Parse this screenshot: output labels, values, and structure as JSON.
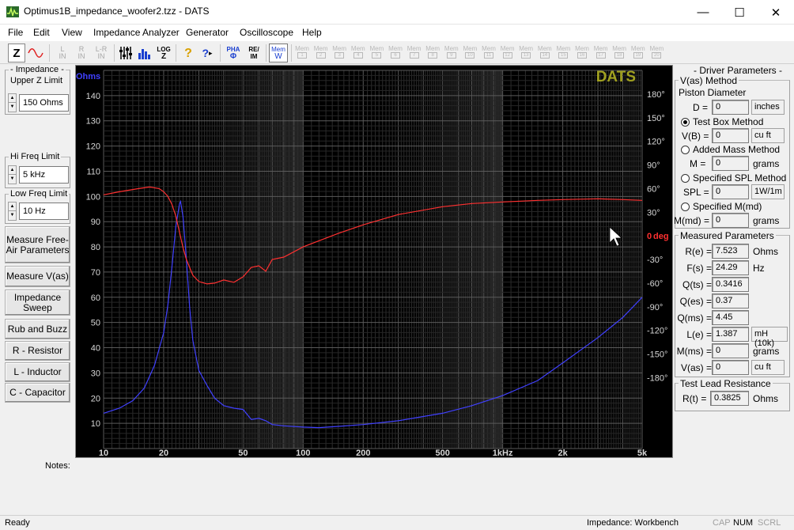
{
  "window": {
    "title": "Optimus1B_impedance_woofer2.tzz - DATS",
    "minimize_glyph": "—",
    "maximize_glyph": "☐",
    "close_glyph": "✕"
  },
  "menu": [
    "File",
    "Edit",
    "View",
    "Impedance Analyzer",
    "Generator",
    "Oscilloscope",
    "Help"
  ],
  "toolbar": {
    "z_label": "Z",
    "l_in": "L IN",
    "r_in": "R IN",
    "lr_in": "L-R IN",
    "log_label": "LOG",
    "log_sub": "Z",
    "help_glyph": "?",
    "context_help_glyph": "?",
    "pha_label": "PHA",
    "pha_sub": "Φ",
    "re_im_top": "RE/",
    "re_im_bottom": "IM",
    "mem_label": "Mem",
    "mem_sub": "W",
    "mem_slot_label": "Mem",
    "mem_slots": [
      "1",
      "2",
      "3",
      "4",
      "5",
      "6",
      "7",
      "8",
      "9",
      "10",
      "11",
      "12",
      "13",
      "14",
      "15",
      "16",
      "17",
      "18",
      "19",
      "20"
    ]
  },
  "left": {
    "upper_z": {
      "legend1": "- Impedance -",
      "legend2": "Upper Z Limit",
      "value": "150 Ohms"
    },
    "hi_freq": {
      "legend": "Hi Freq Limit",
      "value": "5 kHz"
    },
    "low_freq": {
      "legend": "Low Freq Limit",
      "value": "10 Hz"
    },
    "buttons": {
      "measure_free_air": "Measure Free-Air Parameters",
      "measure_vas": "Measure V(as)",
      "impedance_sweep": "Impedance Sweep",
      "rub_buzz": "Rub and Buzz",
      "resistor": "R - Resistor",
      "inductor": "L - Inductor",
      "capacitor": "C - Capacitor"
    }
  },
  "right": {
    "header": "- Driver Parameters -",
    "vas_method": "V(as) Method",
    "piston_diameter": "Piston Diameter",
    "d_label": "D =",
    "d_value": "0",
    "d_unit": "inches",
    "test_box": "Test Box Method",
    "vb_label": "V(B) =",
    "vb_value": "0",
    "vb_unit": "cu ft",
    "added_mass": "Added Mass Method",
    "m_label": "M =",
    "m_value": "0",
    "m_unit": "grams",
    "spec_spl": "Specified SPL Method",
    "spl_label": "SPL =",
    "spl_value": "0",
    "spl_unit": "1W/1m",
    "spec_md": "Specified M(md)",
    "mmd_label": "M(md) =",
    "mmd_value": "0",
    "mmd_unit": "grams",
    "measured_header": "Measured Parameters",
    "measured": [
      {
        "label": "R(e) =",
        "value": "7.523",
        "unit": "Ohms"
      },
      {
        "label": "F(s) =",
        "value": "24.29",
        "unit": "Hz"
      },
      {
        "label": "Q(ts) =",
        "value": "0.3416",
        "unit": ""
      },
      {
        "label": "Q(es) =",
        "value": "0.37",
        "unit": ""
      },
      {
        "label": "Q(ms) =",
        "value": "4.45",
        "unit": ""
      },
      {
        "label": "L(e) =",
        "value": "1.387",
        "unit": "mH (10k)"
      },
      {
        "label": "M(ms) =",
        "value": "0",
        "unit": "grams"
      },
      {
        "label": "V(as) =",
        "value": "0",
        "unit": "cu ft"
      }
    ],
    "test_lead_header": "Test Lead Resistance",
    "rt_label": "R(t) =",
    "rt_value": "0.3825",
    "rt_unit": "Ohms"
  },
  "notes_label": "Notes:",
  "status": {
    "left": "Ready",
    "mode": "Impedance: Workbench",
    "cap": "CAP",
    "num": "NUM",
    "scrl": "SCRL"
  },
  "chart_data": {
    "type": "line",
    "watermark": "DATS",
    "x_scale": "log",
    "xlim": [
      10,
      5000
    ],
    "x_ticks": [
      10,
      20,
      50,
      100,
      200,
      500,
      1000,
      2000,
      5000
    ],
    "x_tick_labels": [
      "10",
      "20",
      "50",
      "100",
      "200",
      "500",
      "1kHz",
      "2k",
      "5k"
    ],
    "ylim": [
      0,
      150
    ],
    "ylabel": "Ohms",
    "y_ticks": [
      10,
      20,
      30,
      40,
      50,
      60,
      70,
      80,
      90,
      100,
      110,
      120,
      130,
      140
    ],
    "y2lim": [
      -270,
      210
    ],
    "y2label": "deg",
    "y2_ticks": [
      180,
      150,
      120,
      90,
      60,
      30,
      0,
      -30,
      -60,
      -90,
      -120,
      -150,
      -180
    ],
    "y2_tick_labels": [
      "180°",
      "150°",
      "120°",
      "90°",
      "60°",
      "30°",
      "0",
      "-30°",
      "-60°",
      "-90°",
      "-120°",
      "-150°",
      "-180°"
    ],
    "grid": true,
    "colors": {
      "impedance": "#4040ff",
      "phase": "#ff3030",
      "left_axis": "#4040ff",
      "right_axis": "#ff3030",
      "watermark": "#a0a020"
    },
    "series": [
      {
        "key": "impedance",
        "axis": "left",
        "x": [
          10,
          12,
          14,
          16,
          18,
          20,
          21,
          22,
          23,
          24,
          24.3,
          25,
          26,
          27,
          28,
          30,
          33,
          36,
          40,
          45,
          50,
          55,
          60,
          65,
          70,
          80,
          100,
          120,
          150,
          200,
          300,
          500,
          700,
          1000,
          1500,
          2000,
          3000,
          4000,
          5000
        ],
        "y": [
          14,
          16,
          19,
          24,
          33,
          46,
          57,
          72,
          88,
          97,
          98,
          92,
          75,
          56,
          43,
          31,
          25,
          20,
          17,
          16,
          15.5,
          11.5,
          12,
          11,
          9.5,
          9,
          8.5,
          8.3,
          8.8,
          9.5,
          11,
          14,
          17,
          21,
          27,
          34,
          44,
          52,
          60
        ]
      },
      {
        "key": "phase",
        "axis": "right",
        "x": [
          10,
          12,
          15,
          17,
          19,
          20,
          21,
          22,
          23,
          24,
          25,
          26,
          28,
          30,
          33,
          36,
          40,
          45,
          50,
          55,
          60,
          65,
          70,
          80,
          100,
          150,
          200,
          300,
          500,
          700,
          1000,
          1500,
          2000,
          3000,
          4000,
          5000
        ],
        "y": [
          52,
          56,
          60,
          62,
          60,
          56,
          50,
          40,
          25,
          5,
          -15,
          -30,
          -50,
          -58,
          -61,
          -60,
          -56,
          -59,
          -52,
          -40,
          -38,
          -45,
          -30,
          -27,
          -14,
          3,
          14,
          27,
          37,
          41,
          43,
          45,
          46,
          47,
          46,
          45
        ]
      }
    ]
  }
}
